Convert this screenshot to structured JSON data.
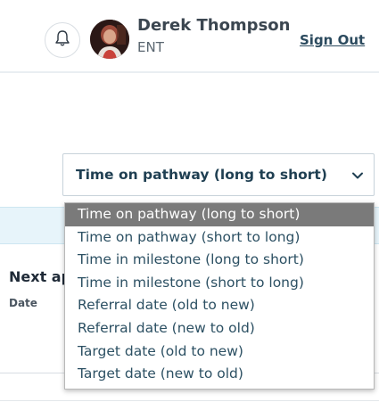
{
  "header": {
    "user_name": "Derek Thompson",
    "user_role": "ENT",
    "sign_out_label": "Sign Out"
  },
  "sort": {
    "selected": "Time on pathway (long to short)",
    "options": [
      "Time on pathway (long to short)",
      "Time on pathway (short to long)",
      "Time in milestone (long to short)",
      "Time in milestone (short to long)",
      "Referral date (old to new)",
      "Referral date (new to old)",
      "Target date (old to new)",
      "Target date (new to old)"
    ],
    "highlighted_index": 0
  },
  "card": {
    "title_partial": "Next ap",
    "subtitle": "Date"
  },
  "colors": {
    "highlight": "#7a7a7a",
    "option_text": "#2c5063",
    "band": "#e7f4fa"
  }
}
